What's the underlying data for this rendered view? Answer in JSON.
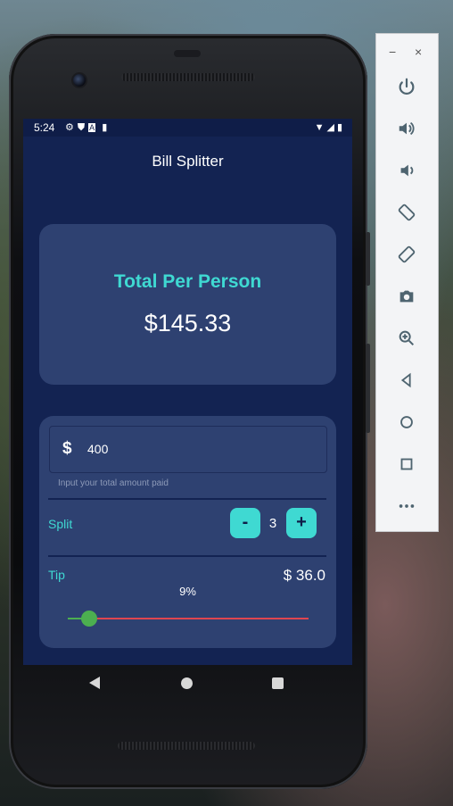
{
  "status_bar": {
    "time": "5:24",
    "left_icons": [
      "gear-icon",
      "shield-icon",
      "a-icon",
      "sd-card-icon"
    ],
    "right_icons": [
      "wifi-icon",
      "signal-icon",
      "battery-icon"
    ]
  },
  "app": {
    "title": "Bill Splitter"
  },
  "total_card": {
    "label": "Total Per Person",
    "value": "$145.33"
  },
  "amount_input": {
    "icon": "dollar-icon",
    "symbol": "$",
    "value": "400",
    "helper": "Input your total amount paid"
  },
  "split": {
    "label": "Split",
    "minus_label": "-",
    "count": "3",
    "plus_label": "+"
  },
  "tip": {
    "label": "Tip",
    "amount": "$ 36.0",
    "percent_label": "9%",
    "slider_fraction": 0.09
  },
  "colors": {
    "background": "#132352",
    "card": "#2e4171",
    "accent": "#3fd9d2",
    "slider_active": "#4caf50",
    "slider_inactive": "#e0454f"
  },
  "nav_bar": {
    "buttons": [
      "back-icon",
      "home-icon",
      "recents-icon"
    ]
  },
  "emulator_panel": {
    "window_controls": {
      "minimize": "−",
      "close": "×"
    },
    "buttons": [
      "power-icon",
      "volume-up-icon",
      "volume-down-icon",
      "rotate-left-icon",
      "rotate-right-icon",
      "camera-icon",
      "zoom-icon",
      "back-icon",
      "home-icon",
      "overview-icon",
      "more-icon"
    ]
  }
}
